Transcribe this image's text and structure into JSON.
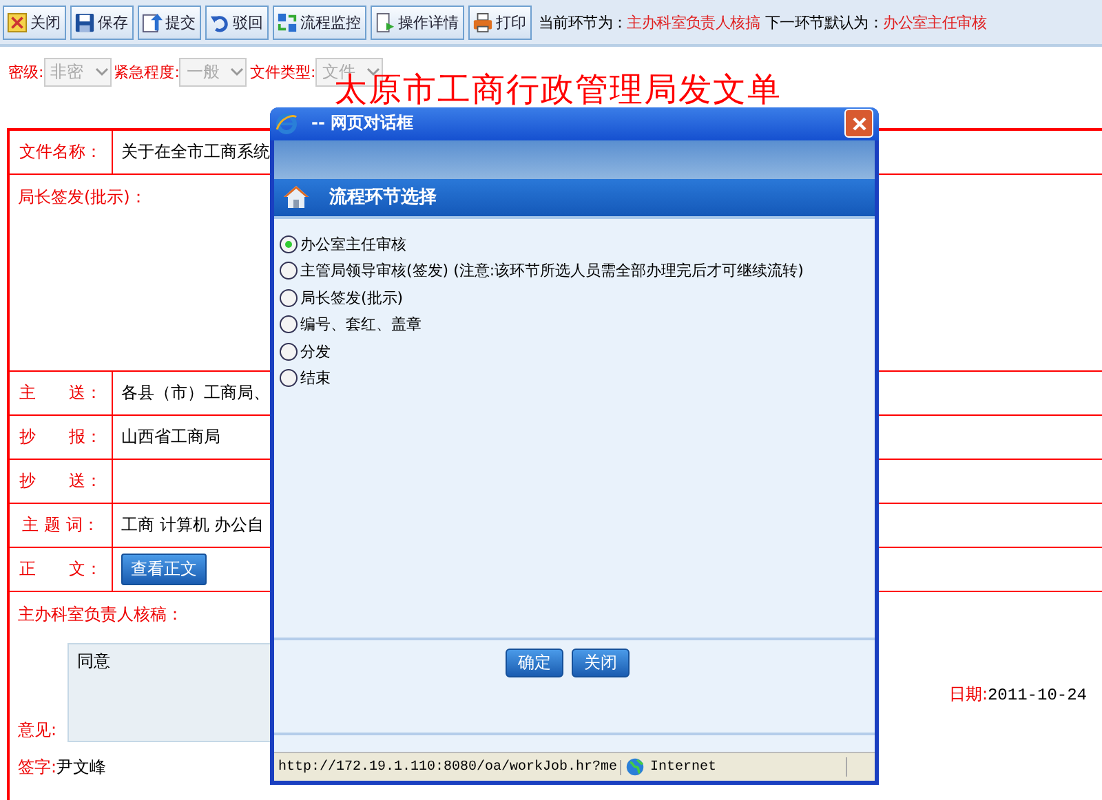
{
  "toolbar": {
    "buttons": [
      {
        "label": "关闭"
      },
      {
        "label": "保存"
      },
      {
        "label": "提交"
      },
      {
        "label": "驳回"
      },
      {
        "label": "流程监控"
      },
      {
        "label": "操作详情"
      },
      {
        "label": "打印"
      }
    ],
    "status": [
      {
        "kind": "label",
        "text": "当前环节为："
      },
      {
        "kind": "value",
        "text": "主办科室负责人核搞"
      },
      {
        "kind": "label",
        "text": "下一环节默认为："
      },
      {
        "kind": "value",
        "text": "办公室主任审核"
      }
    ]
  },
  "selects": [
    {
      "label": "密级:",
      "value": "非密"
    },
    {
      "label": "紧急程度:",
      "value": "一般"
    },
    {
      "label": "文件类型:",
      "value": "文件"
    }
  ],
  "form_title": "太原市工商行政管理局发文单",
  "form_rows": [
    {
      "kind": "text",
      "label": "文件名称：",
      "value": "关于在全市工商系统"
    },
    {
      "kind": "block",
      "label": "局长签发(批示)："
    },
    {
      "kind": "text",
      "label": "主　　送：",
      "value": "各县（市）工商局、"
    },
    {
      "kind": "text",
      "label": "抄　　报：",
      "value": "山西省工商局"
    },
    {
      "kind": "text",
      "label": "抄　　送：",
      "value": ""
    },
    {
      "kind": "text",
      "label": "主 题 词：",
      "value": "工商  计算机  办公自"
    },
    {
      "kind": "button",
      "label": "正　　文：",
      "value": "查看正文"
    }
  ],
  "review": {
    "title": "主办科室负责人核稿：",
    "opinion": "同意",
    "opinion_label": "意见:",
    "date_label": "日期:",
    "date": "2011-10-24",
    "sign_label": "签字:",
    "signer": "尹文峰"
  },
  "dialog": {
    "title": "-- 网页对话框",
    "heading": "流程环节选择",
    "options": [
      {
        "label": "办公室主任审核",
        "selected": true
      },
      {
        "label": "主管局领导审核(签发) (注意:该环节所选人员需全部办理完后才可继续流转)",
        "selected": false
      },
      {
        "label": "局长签发(批示)",
        "selected": false
      },
      {
        "label": "编号、套红、盖章",
        "selected": false
      },
      {
        "label": "分发",
        "selected": false
      },
      {
        "label": "结束",
        "selected": false
      }
    ],
    "buttons": [
      "确定",
      "关闭"
    ],
    "status_url": "http://172.19.1.110:8080/oa/workJob.hr?me",
    "status_zone": "Internet"
  }
}
